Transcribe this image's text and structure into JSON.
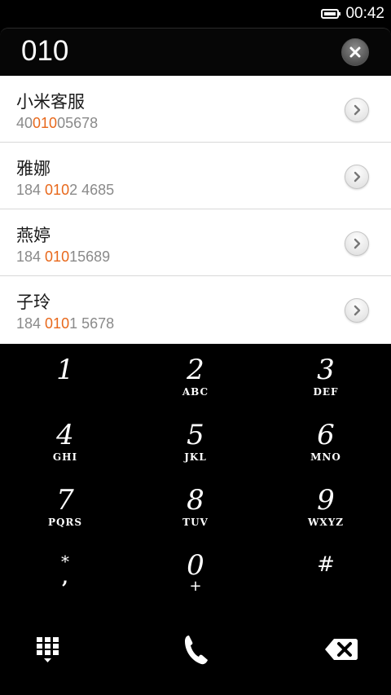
{
  "status_bar": {
    "time": "00:42",
    "battery_icon": "battery-icon"
  },
  "dialer": {
    "dialed_number": "010",
    "clear_icon": "close-circle-icon"
  },
  "contacts": [
    {
      "name": "小米客服",
      "number_pre": "40",
      "number_match": "010",
      "number_post": "05678"
    },
    {
      "name": "雅娜",
      "number_pre": "184 ",
      "number_match": "010",
      "number_post": "2 4685"
    },
    {
      "name": "燕婷",
      "number_pre": "184 ",
      "number_match": "010",
      "number_post": "15689"
    },
    {
      "name": "子玲",
      "number_pre": "184 ",
      "number_match": "010",
      "number_post": "1 5678"
    }
  ],
  "keypad": {
    "keys": [
      {
        "digit": "1",
        "letters": ""
      },
      {
        "digit": "2",
        "letters": "ABC"
      },
      {
        "digit": "3",
        "letters": "DEF"
      },
      {
        "digit": "4",
        "letters": "GHI"
      },
      {
        "digit": "5",
        "letters": "JKL"
      },
      {
        "digit": "6",
        "letters": "MNO"
      },
      {
        "digit": "7",
        "letters": "PQRS"
      },
      {
        "digit": "8",
        "letters": "TUV"
      },
      {
        "digit": "9",
        "letters": "WXYZ"
      },
      {
        "digit": "*",
        "letters": ","
      },
      {
        "digit": "0",
        "letters": "+"
      },
      {
        "digit": "#",
        "letters": ""
      }
    ]
  },
  "actions": {
    "keypad_toggle_icon": "dialpad-icon",
    "call_icon": "phone-icon",
    "backspace_icon": "backspace-icon"
  },
  "colors": {
    "highlight": "#e8681b",
    "list_background": "#ffffff",
    "keypad_background": "#000000"
  }
}
